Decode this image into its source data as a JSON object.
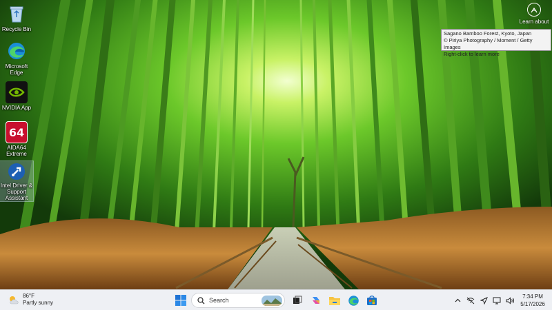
{
  "desktop": {
    "icons": [
      {
        "label": "Recycle Bin",
        "icon": "recycle-bin-icon"
      },
      {
        "label": "Microsoft Edge",
        "icon": "edge-icon"
      },
      {
        "label": "NVIDIA App",
        "icon": "nvidia-icon"
      },
      {
        "label": "AIDA64 Extreme",
        "icon": "aida64-icon",
        "badge": "64"
      },
      {
        "label": "Intel Driver & Support Assistant",
        "icon": "intel-dsa-icon"
      }
    ],
    "learn_about": {
      "label": "Learn about",
      "icon": "camera-lens-icon"
    },
    "tooltip": {
      "line1": "Sagano Bamboo Forest, Kyoto, Japan",
      "line2": "© Piriya Photography / Moment / Getty Images",
      "line3": "Right-click to learn more"
    }
  },
  "taskbar": {
    "weather": {
      "temp": "86°F",
      "condition": "Partly sunny",
      "icon": "partly-sunny-icon"
    },
    "search": {
      "placeholder": "Search",
      "icon": "search-icon"
    },
    "apps": [
      "start-icon",
      "task-view-icon",
      "copilot-icon",
      "file-explorer-icon",
      "edge-icon",
      "store-icon"
    ],
    "tray": [
      "chevron-up-icon",
      "network-off-icon",
      "location-icon",
      "display-icon",
      "volume-icon"
    ],
    "clock": {
      "time": "7:34 PM",
      "date": "5/17/2026"
    }
  },
  "colors": {
    "taskbar_bg": "#eef0f4",
    "foliage": "#7ad630",
    "grass": "#b8742c"
  }
}
